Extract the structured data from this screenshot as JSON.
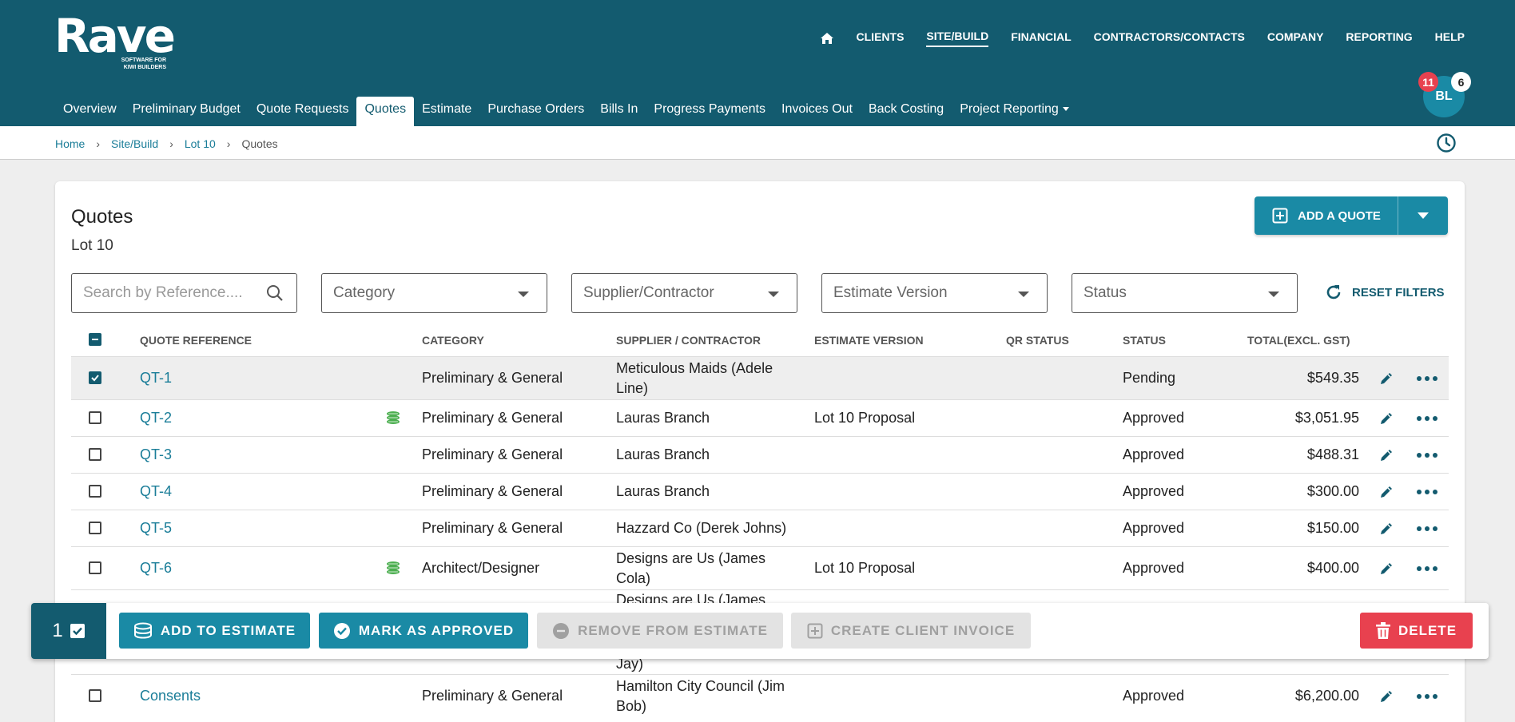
{
  "logo": {
    "name": "Rave",
    "tagline_line1": "SOFTWARE FOR",
    "tagline_line2": "KIWI BUILDERS"
  },
  "main_nav": {
    "items": [
      "CLIENTS",
      "SITE/BUILD",
      "FINANCIAL",
      "CONTRACTORS/CONTACTS",
      "COMPANY",
      "REPORTING",
      "HELP"
    ],
    "active": "SITE/BUILD"
  },
  "sub_nav": {
    "tabs": [
      "Overview",
      "Preliminary Budget",
      "Quote Requests",
      "Quotes",
      "Estimate",
      "Purchase Orders",
      "Bills In",
      "Progress Payments",
      "Invoices Out",
      "Back Costing",
      "Project Reporting"
    ],
    "active": "Quotes"
  },
  "user": {
    "initials": "BL",
    "notifications": "11",
    "messages": "6"
  },
  "breadcrumb": {
    "home": "Home",
    "site_build": "Site/Build",
    "lot": "Lot 10",
    "current": "Quotes"
  },
  "page": {
    "title": "Quotes",
    "subtitle": "Lot 10"
  },
  "add_quote_label": "ADD A QUOTE",
  "filters": {
    "search_placeholder": "Search by Reference....",
    "category": "Category",
    "supplier": "Supplier/Contractor",
    "estimate_version": "Estimate Version",
    "status": "Status",
    "reset_label": "RESET FILTERS"
  },
  "table": {
    "headers": {
      "reference": "QUOTE REFERENCE",
      "category": "CATEGORY",
      "supplier": "SUPPLIER / CONTRACTOR",
      "estimate_version": "ESTIMATE VERSION",
      "qr_status": "QR STATUS",
      "status": "STATUS",
      "total": "TOTAL(EXCL. GST)"
    },
    "rows": [
      {
        "ref": "QT-1",
        "category": "Preliminary & General",
        "supplier_1": "Meticulous Maids (Adele",
        "supplier_2": "Line)",
        "estimate": "",
        "qr_status": "",
        "status": "Pending",
        "total": "$549.35"
      },
      {
        "ref": "QT-2",
        "category": "Preliminary & General",
        "supplier_1": "Lauras Branch",
        "supplier_2": "",
        "estimate": "Lot 10 Proposal",
        "qr_status": "",
        "status": "Approved",
        "total": "$3,051.95"
      },
      {
        "ref": "QT-3",
        "category": "Preliminary & General",
        "supplier_1": "Lauras Branch",
        "supplier_2": "",
        "estimate": "",
        "qr_status": "",
        "status": "Approved",
        "total": "$488.31"
      },
      {
        "ref": "QT-4",
        "category": "Preliminary & General",
        "supplier_1": "Lauras Branch",
        "supplier_2": "",
        "estimate": "",
        "qr_status": "",
        "status": "Approved",
        "total": "$300.00"
      },
      {
        "ref": "QT-5",
        "category": "Preliminary & General",
        "supplier_1": "Hazzard Co (Derek Johns)",
        "supplier_2": "",
        "estimate": "",
        "qr_status": "",
        "status": "Approved",
        "total": "$150.00"
      },
      {
        "ref": "QT-6",
        "category": "Architect/Designer",
        "supplier_1": "Designs are Us (James",
        "supplier_2": "Cola)",
        "estimate": "Lot 10 Proposal",
        "qr_status": "",
        "status": "Approved",
        "total": "$400.00"
      },
      {
        "ref": "",
        "category": "",
        "supplier_1": "Designs are Us (James",
        "supplier_2": "Jay)",
        "estimate": "",
        "qr_status": "",
        "status": "",
        "total": ""
      },
      {
        "ref": "Consents",
        "category": "Preliminary & General",
        "supplier_1": "Hamilton City Council (Jim",
        "supplier_2": "Bob)",
        "estimate": "",
        "qr_status": "",
        "status": "Approved",
        "total": "$6,200.00"
      }
    ]
  },
  "action_bar": {
    "selected_count": "1",
    "add_to_estimate": "ADD TO ESTIMATE",
    "mark_as_approved": "MARK AS APPROVED",
    "remove_from_estimate": "REMOVE FROM ESTIMATE",
    "create_client_invoice": "CREATE CLIENT INVOICE",
    "delete": "DELETE"
  },
  "colors": {
    "primary": "#135b6f",
    "accent": "#1a8aa5",
    "danger": "#e8414f",
    "coin": "#4caf50"
  }
}
